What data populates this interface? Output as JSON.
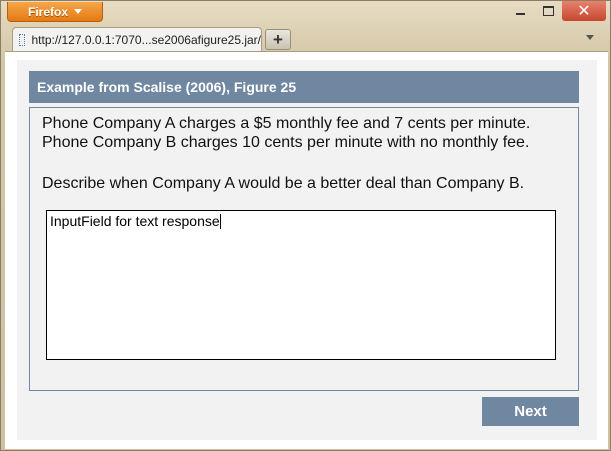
{
  "browser": {
    "app_button_label": "Firefox",
    "tab_title": "http://127.0.0.1:7070...se2006afigure25.jar/",
    "new_tab_label": "+"
  },
  "page": {
    "title": "Example from Scalise (2006), Figure 25",
    "lines": [
      "Phone Company A charges a $5 monthly fee and 7 cents per minute.",
      "Phone Company B charges 10 cents per minute with no monthly fee.",
      "Describe when Company A would be a better deal than Company B."
    ],
    "response_text": "InputField for text response",
    "next_label": "Next"
  },
  "colors": {
    "accent": "#6f87a0",
    "firefox_orange": "#e47a12",
    "close_red": "#c6462e"
  }
}
